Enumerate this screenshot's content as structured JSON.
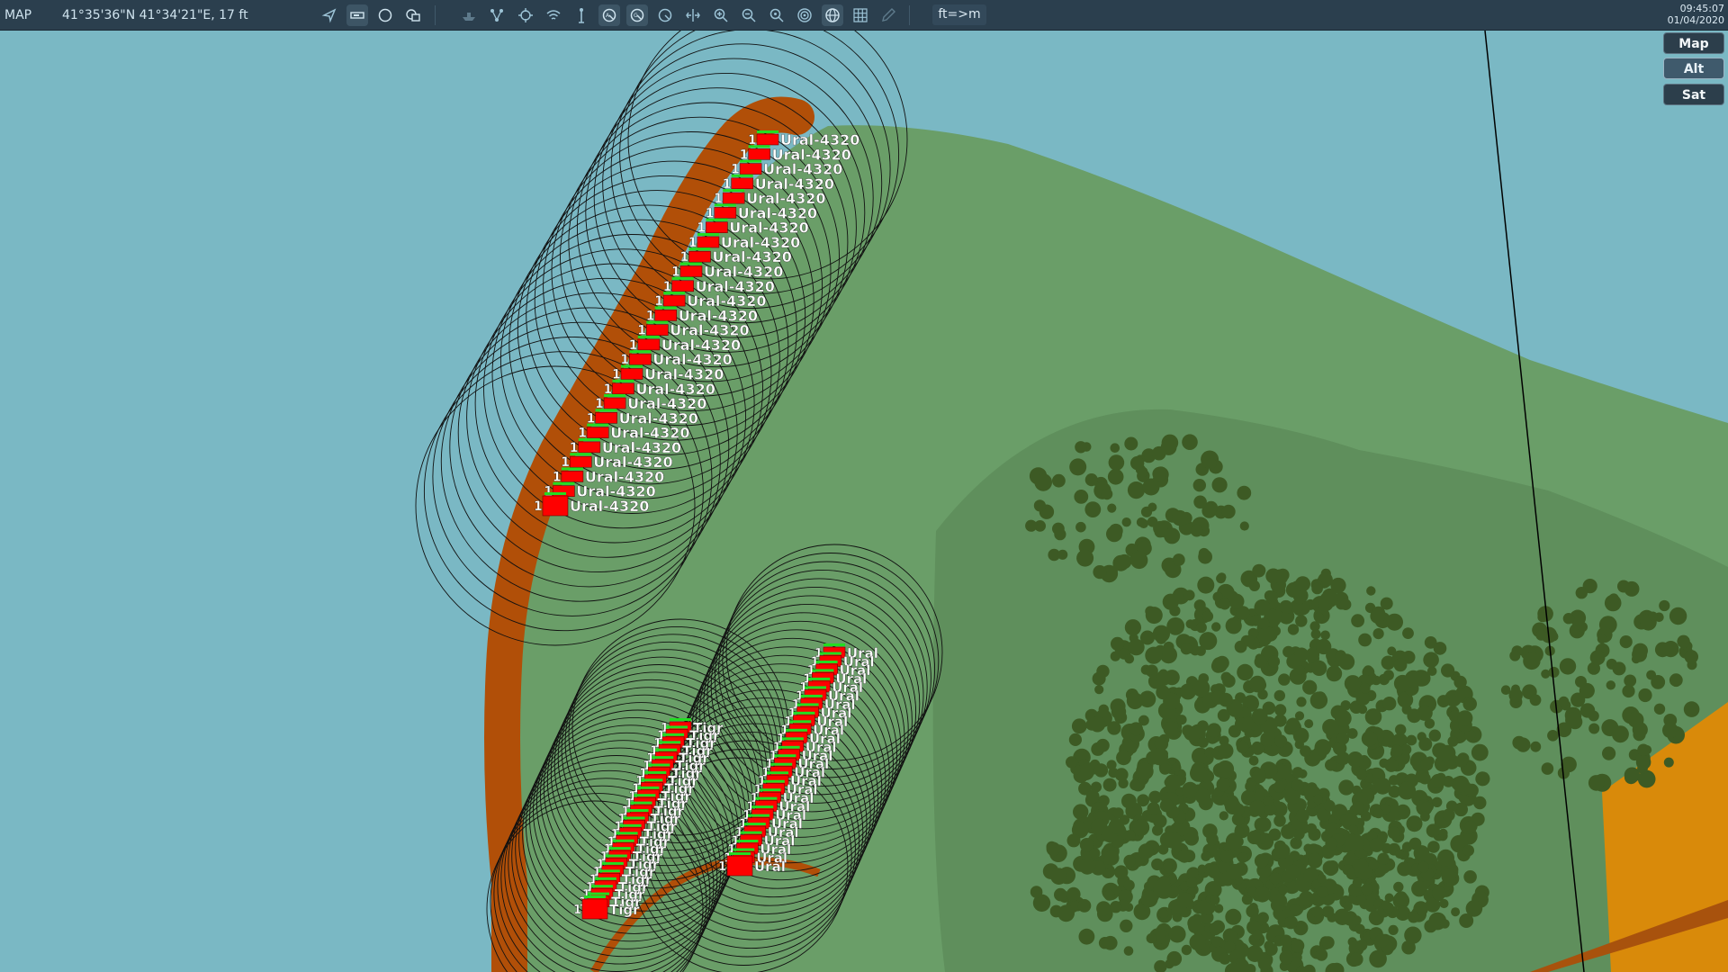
{
  "toolbar": {
    "mode_label": "MAP",
    "coordinates": "41°35'36\"N 41°34'21\"E, 17 ft",
    "units_toggle": "ft=>m",
    "icons": [
      "navigate-icon",
      "ruler-icon",
      "circle-icon",
      "layers-icon",
      "ship-icon",
      "network-icon",
      "crosshair-icon",
      "wifi-icon",
      "tower-icon",
      "radar-a-icon",
      "radar-b-icon",
      "radar-c-icon",
      "split-icon",
      "zoom-in-icon",
      "zoom-out-icon",
      "zoom-fit-icon",
      "target-icon",
      "globe-icon",
      "grid-icon",
      "pencil-icon"
    ]
  },
  "clock": {
    "time": "09:45:07",
    "date": "01/04/2020"
  },
  "layers": {
    "map": "Map",
    "alt": "Alt",
    "sat": "Sat",
    "selected": "Alt"
  },
  "colors": {
    "sea": "#7ab8c4",
    "land": "#6a9e68",
    "road": "#b14f08",
    "unit": "#ff0000",
    "health": "#22dd22",
    "forest": "#3d5a24",
    "field": "#d98a0a"
  },
  "units": {
    "column_a": {
      "type": "Ural-4320",
      "group": "1",
      "count": 26
    },
    "column_b": {
      "type": "Tigr",
      "group": "1",
      "count": 25
    },
    "column_c": {
      "type": "Ural",
      "group": "1",
      "count": 26
    }
  }
}
